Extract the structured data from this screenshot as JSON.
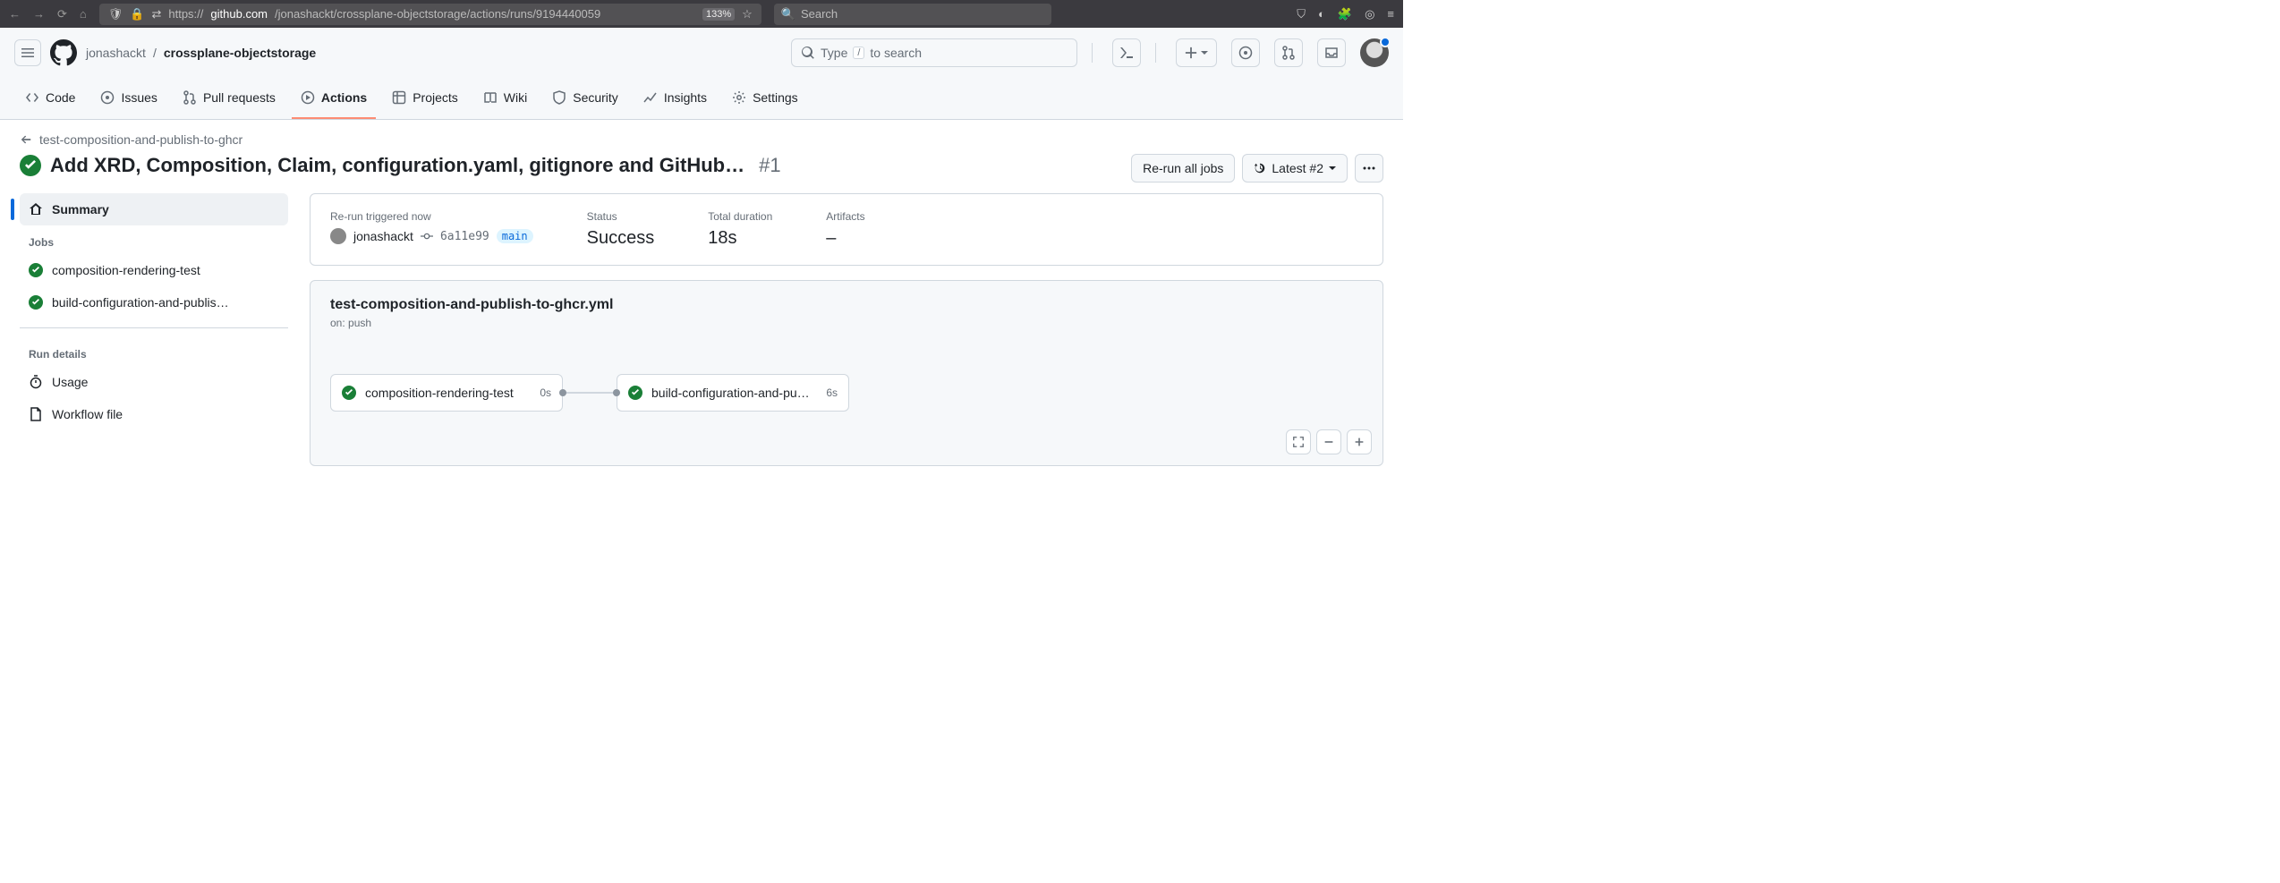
{
  "browser": {
    "url_scheme": "https://",
    "url_host": "github.com",
    "url_path": "/jonashackt/crossplane-objectstorage/actions/runs/9194440059",
    "zoom": "133%",
    "search_placeholder": "Search"
  },
  "header": {
    "owner": "jonashackt",
    "repo": "crossplane-objectstorage",
    "search_pre": "Type",
    "search_kbd": "/",
    "search_post": "to search"
  },
  "repo_nav": {
    "code": "Code",
    "issues": "Issues",
    "pulls": "Pull requests",
    "actions": "Actions",
    "projects": "Projects",
    "wiki": "Wiki",
    "security": "Security",
    "insights": "Insights",
    "settings": "Settings"
  },
  "run": {
    "back": "test-composition-and-publish-to-ghcr",
    "title": "Add XRD, Composition, Claim, configuration.yaml, gitignore and GitHub…",
    "number": "#1",
    "rerun": "Re-run all jobs",
    "latest": "Latest #2"
  },
  "sidebar": {
    "summary": "Summary",
    "jobs_h": "Jobs",
    "job1": "composition-rendering-test",
    "job2": "build-configuration-and-publis…",
    "run_details_h": "Run details",
    "usage": "Usage",
    "workflow_file": "Workflow file"
  },
  "meta": {
    "trig_l": "Re-run triggered now",
    "user": "jonashackt",
    "sha": "6a11e99",
    "branch": "main",
    "status_l": "Status",
    "status_v": "Success",
    "dur_l": "Total duration",
    "dur_v": "18s",
    "art_l": "Artifacts",
    "art_v": "–"
  },
  "graph": {
    "file": "test-composition-and-publish-to-ghcr.yml",
    "on": "on: push",
    "job1": "composition-rendering-test",
    "job1_d": "0s",
    "job2": "build-configuration-and-pu…",
    "job2_d": "6s"
  }
}
